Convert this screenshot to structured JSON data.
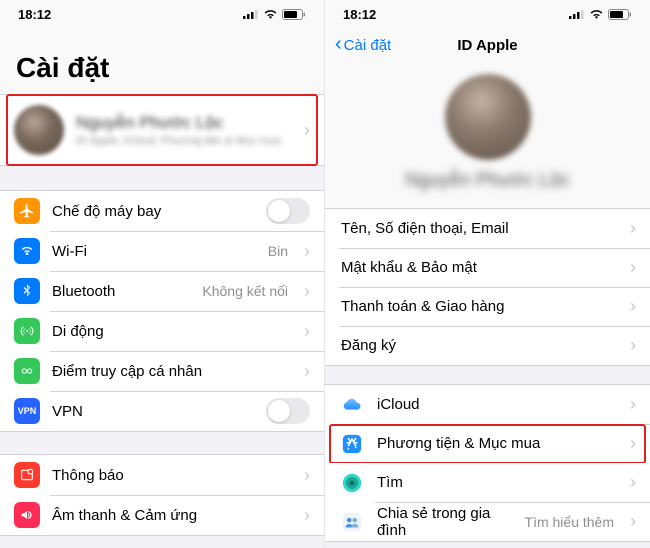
{
  "status": {
    "time": "18:12"
  },
  "left": {
    "title": "Cài đặt",
    "profile": {
      "name": "Nguyễn Phước Lộc",
      "subtitle": "ID Apple, iCloud, Phương tiện & Mục mua"
    },
    "rows": {
      "airplane": "Chế độ máy bay",
      "wifi": "Wi-Fi",
      "wifi_value": "Bin",
      "bluetooth": "Bluetooth",
      "bluetooth_value": "Không kết nối",
      "cellular": "Di động",
      "hotspot": "Điểm truy cập cá nhân",
      "vpn": "VPN",
      "notifications": "Thông báo",
      "sounds": "Âm thanh & Cảm ứng"
    }
  },
  "right": {
    "back": "Cài đặt",
    "title": "ID Apple",
    "hero_name": "Nguyễn Phước Lộc",
    "group1": {
      "name_phone_email": "Tên, Số điện thoại, Email",
      "password_security": "Mật khẩu & Bảo mật",
      "payment_shipping": "Thanh toán & Giao hàng",
      "subscriptions": "Đăng ký"
    },
    "group2": {
      "icloud": "iCloud",
      "media_purchases": "Phương tiện & Mục mua",
      "find": "Tìm",
      "family_sharing": "Chia sẻ trong gia đình",
      "family_value": "Tìm hiểu thêm"
    }
  },
  "colors": {
    "orange": "#ff9500",
    "blue": "#007aff",
    "green": "#34c759",
    "darkgreen": "#2aa84a",
    "vpnblue": "#2663ff",
    "red": "#ff3b30",
    "redpink": "#ff2d55",
    "skyblue": "#2ea5ff",
    "teal": "#2fd6c5"
  }
}
